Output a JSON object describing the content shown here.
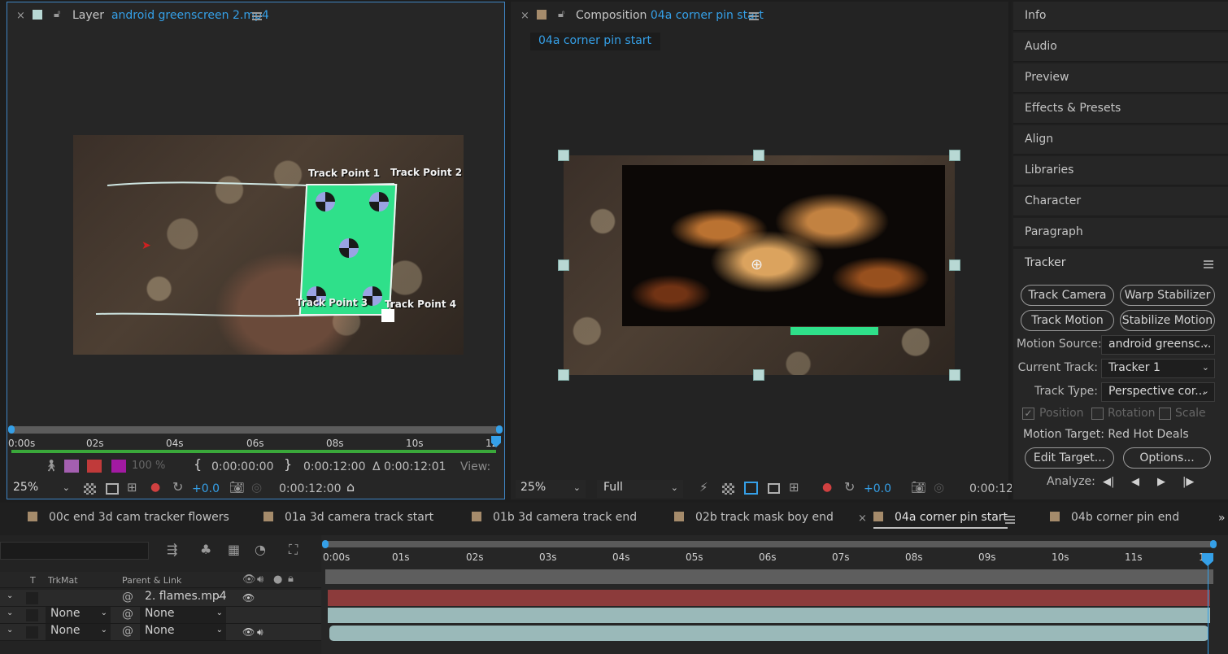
{
  "layer_panel": {
    "label": "Layer",
    "file": "android greenscreen 2.mp4",
    "track_points": [
      "Track Point 1",
      "Track Point 2",
      "Track Point 3",
      "Track Point 4"
    ],
    "ruler": [
      "0:00s",
      "02s",
      "04s",
      "06s",
      "08s",
      "10s",
      "12"
    ],
    "opacity": "100 %",
    "in_time": "0:00:00:00",
    "out_time": "0:00:12:00",
    "duration": "Δ 0:00:12:01",
    "view_label": "View:",
    "zoom": "25%",
    "exposure": "+0.0",
    "current_time": "0:00:12:00"
  },
  "comp_panel": {
    "label": "Composition",
    "name": "04a corner pin start",
    "sub_tab": "04a corner pin start",
    "zoom": "25%",
    "resolution": "Full",
    "exposure": "+0.0",
    "current_time": "0:00:12"
  },
  "right_panel": {
    "items": [
      "Info",
      "Audio",
      "Preview",
      "Effects & Presets",
      "Align",
      "Libraries",
      "Character",
      "Paragraph"
    ],
    "tracker": {
      "title": "Tracker",
      "buttons": [
        "Track Camera",
        "Warp Stabilizer",
        "Track Motion",
        "Stabilize Motion"
      ],
      "motion_source_label": "Motion Source:",
      "motion_source": "android greensc...",
      "current_track_label": "Current Track:",
      "current_track": "Tracker 1",
      "track_type_label": "Track Type:",
      "track_type": "Perspective cor...",
      "checks": [
        "Position",
        "Rotation",
        "Scale"
      ],
      "motion_target": "Motion Target: Red Hot Deals",
      "edit_target": "Edit Target...",
      "options": "Options...",
      "analyze_label": "Analyze:"
    }
  },
  "timeline": {
    "tabs": [
      "00c end 3d cam tracker flowers",
      "01a 3d camera track start",
      "01b 3d camera track end",
      "02b track mask boy end",
      "04a corner pin start",
      "04b corner pin end"
    ],
    "ruler": [
      "0:00s",
      "01s",
      "02s",
      "03s",
      "04s",
      "05s",
      "06s",
      "07s",
      "08s",
      "09s",
      "10s",
      "11s",
      "12"
    ],
    "columns": {
      "t": "T",
      "trkmat": "TrkMat",
      "parent": "Parent & Link"
    },
    "rows": [
      {
        "trkmat": "",
        "parent": "2. flames.mp4"
      },
      {
        "trkmat": "None",
        "parent": "None"
      },
      {
        "trkmat": "None",
        "parent": "None"
      }
    ]
  },
  "colors": {
    "accent": "#35a0e8",
    "green_screen": "#2fe08a",
    "layer_red": "#8c3b3b",
    "layer_teal": "#9ab9b9"
  }
}
